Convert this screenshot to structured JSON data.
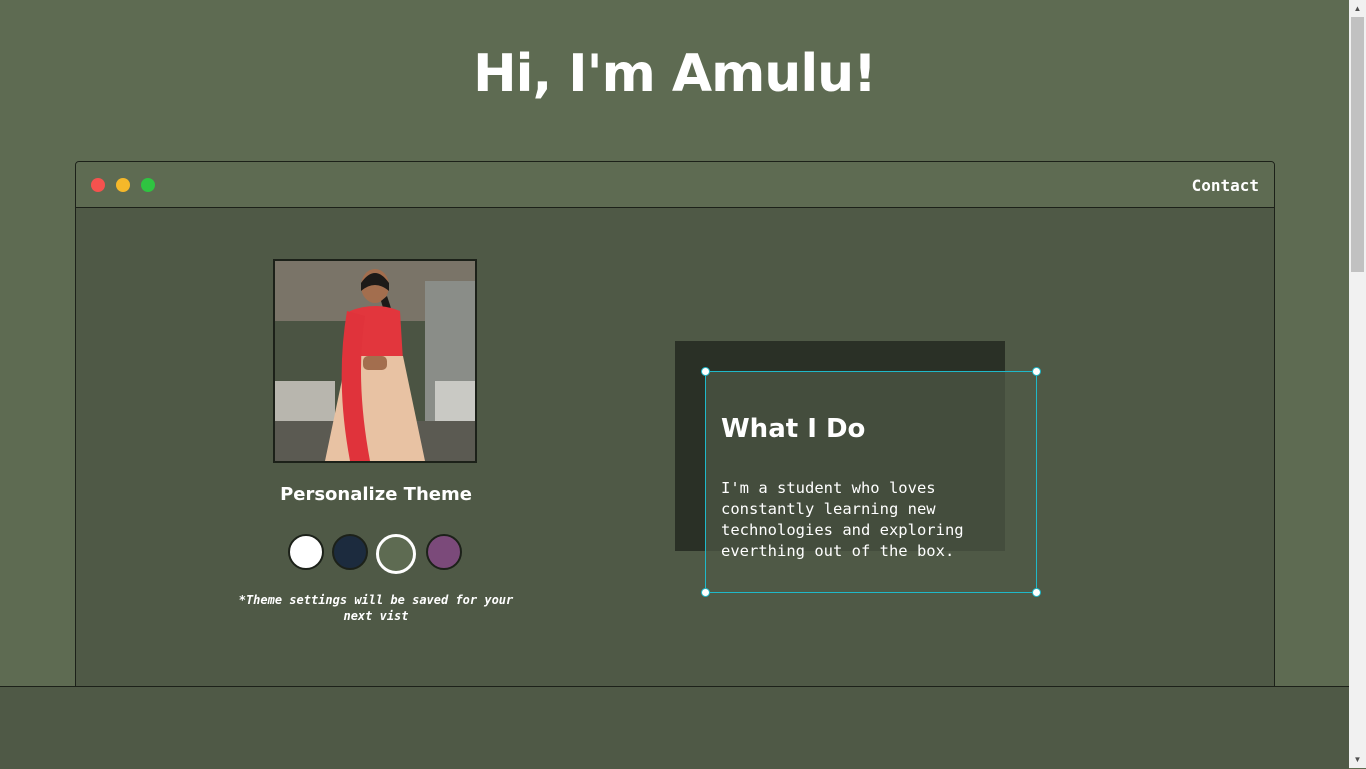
{
  "hero": {
    "title": "Hi, I'm Amulu!"
  },
  "window": {
    "nav_link": "Contact"
  },
  "profile": {
    "alt": "Profile photo of Amulu"
  },
  "theme": {
    "title": "Personalize Theme",
    "note": "*Theme settings will be saved for your next vist",
    "swatches": [
      {
        "name": "light",
        "color": "#ffffff"
      },
      {
        "name": "blue",
        "color": "#1c2b3e"
      },
      {
        "name": "green",
        "color": "#5e6b52",
        "selected": true
      },
      {
        "name": "purple",
        "color": "#7b4a7a"
      }
    ]
  },
  "about": {
    "title": "What I Do",
    "text": "I'm a student who loves constantly learning new technologies and exploring everthing out of the box."
  },
  "colors": {
    "background": "#5e6b52",
    "window": "#4f5946",
    "selection": "#1fb8c8"
  }
}
